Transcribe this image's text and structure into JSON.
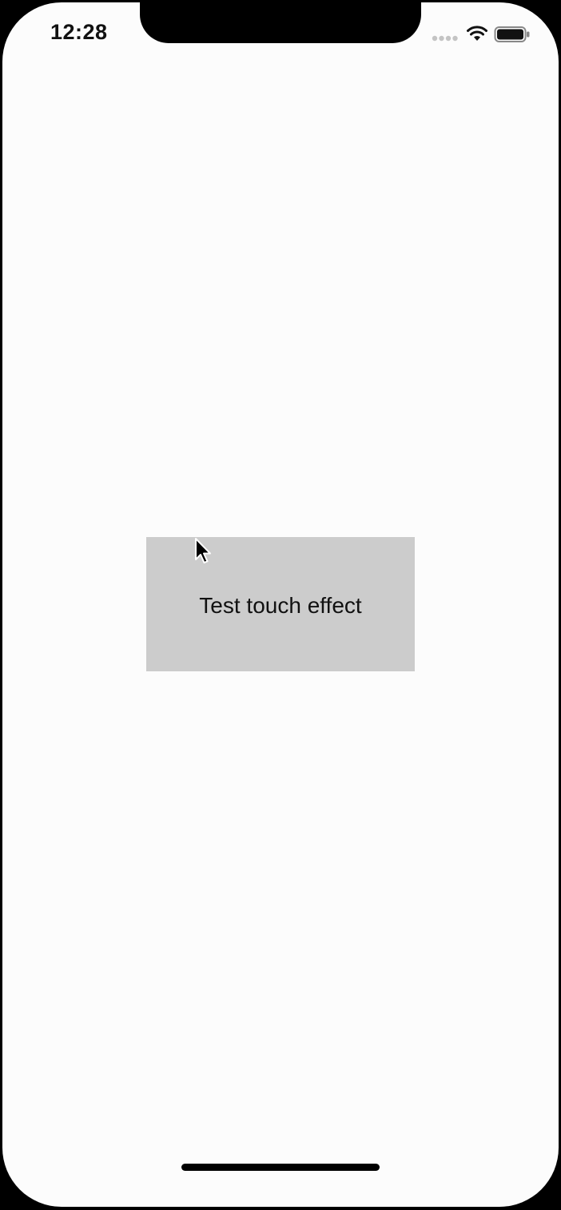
{
  "status_bar": {
    "time": "12:28",
    "signal_icon": "cellular-signal-dots-icon",
    "wifi_icon": "wifi-icon",
    "battery_icon": "battery-icon"
  },
  "main": {
    "touch_button_label": "Test touch effect",
    "touch_button_color": "#cccccc",
    "background_color": "#fcfcfc"
  },
  "overlay": {
    "cursor_icon": "mouse-pointer-icon"
  }
}
